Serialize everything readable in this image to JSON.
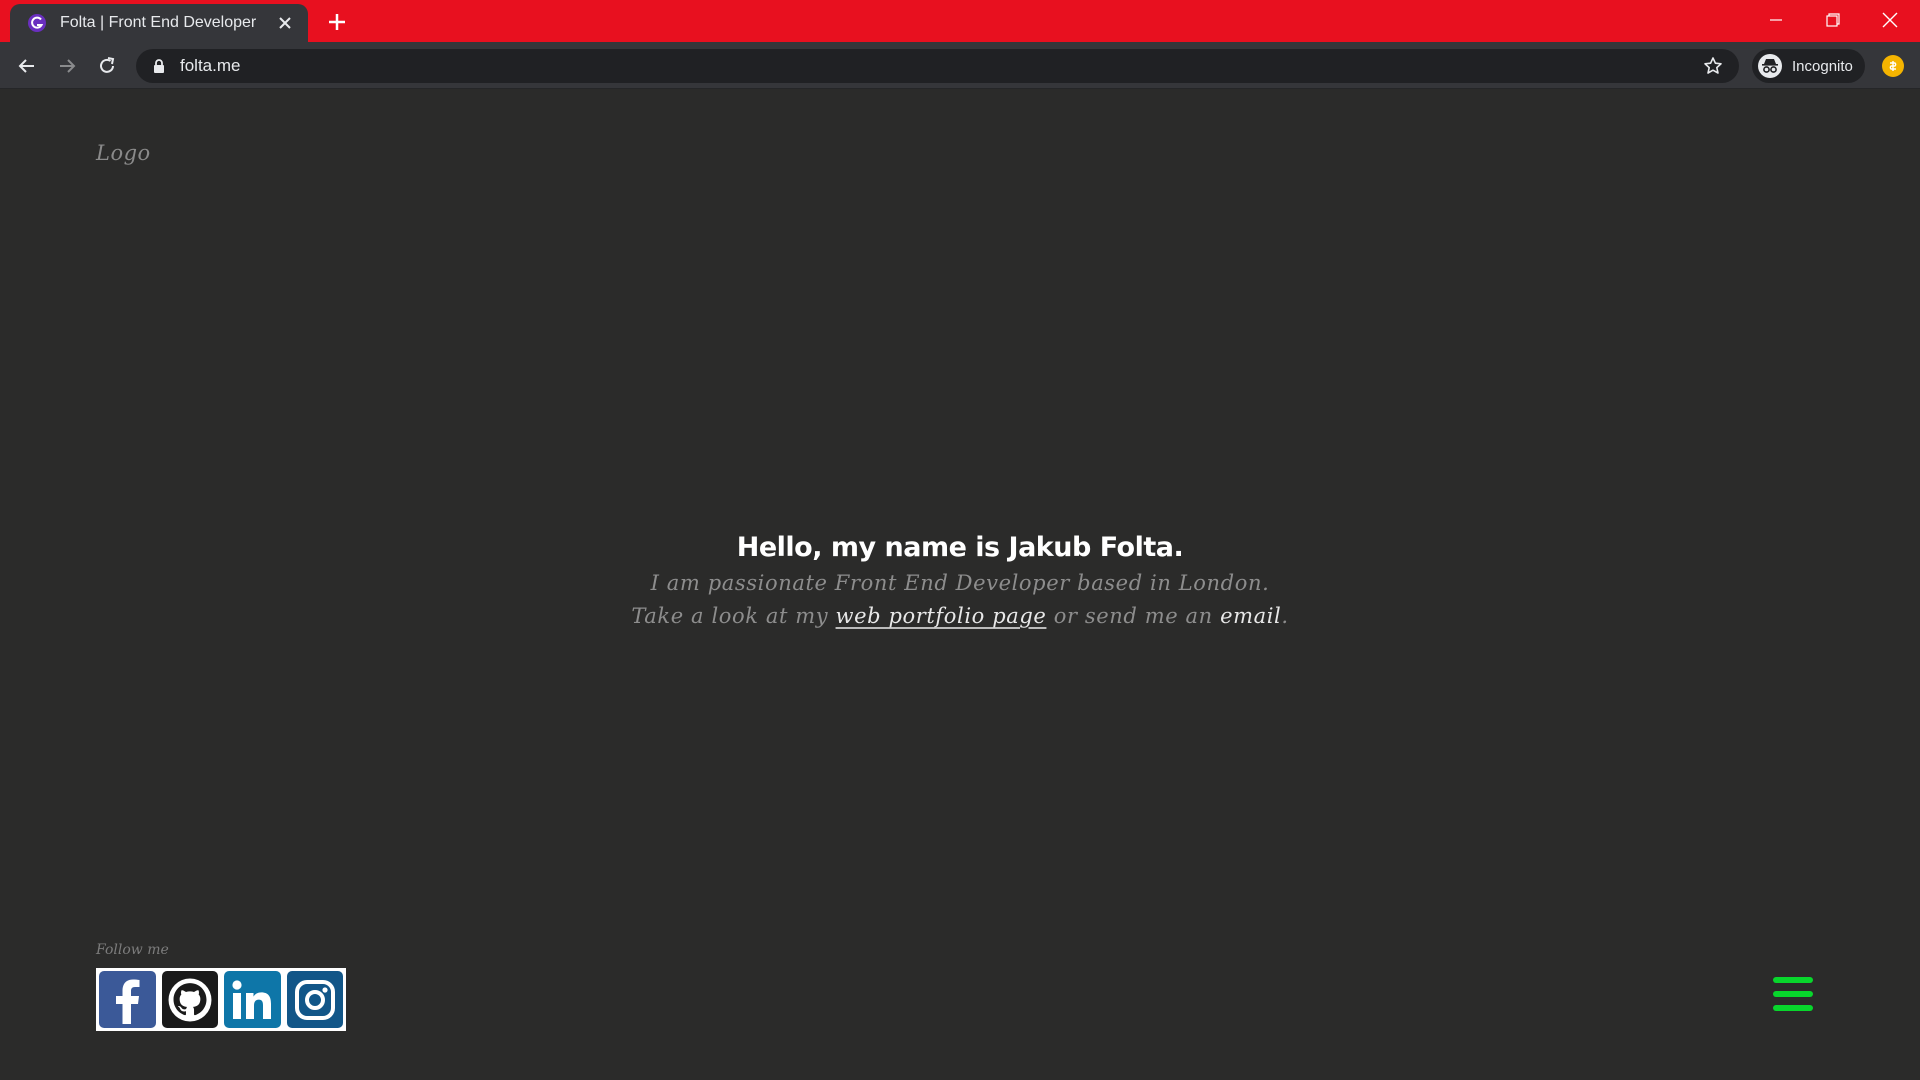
{
  "browser": {
    "tab_title": "Folta | Front End Developer",
    "url": "folta.me",
    "profile_label": "Incognito"
  },
  "page": {
    "logo": "Logo",
    "hero": {
      "title": "Hello, my name is Jakub Folta.",
      "line1": "I am passionate Front End Developer based in London.",
      "line2_prefix": "Take a look at my",
      "portfolio_link": "web portfolio page",
      "line2_middle": "or send me an",
      "email_link": "email",
      "line2_suffix": "."
    },
    "follow_label": "Follow me",
    "socials": [
      {
        "name": "Facebook",
        "icon": "facebook-icon",
        "color": "#3b5998"
      },
      {
        "name": "GitHub",
        "icon": "github-icon",
        "color": "#1a1a1a"
      },
      {
        "name": "LinkedIn",
        "icon": "linkedin-icon",
        "color": "#0e76a8"
      },
      {
        "name": "Instagram",
        "icon": "instagram-icon",
        "color": "#125688"
      }
    ],
    "menu_icon": "hamburger-icon"
  },
  "colors": {
    "titlebar": "#e8101f",
    "background": "#2b2b2a",
    "menu_accent": "#08d62c"
  }
}
